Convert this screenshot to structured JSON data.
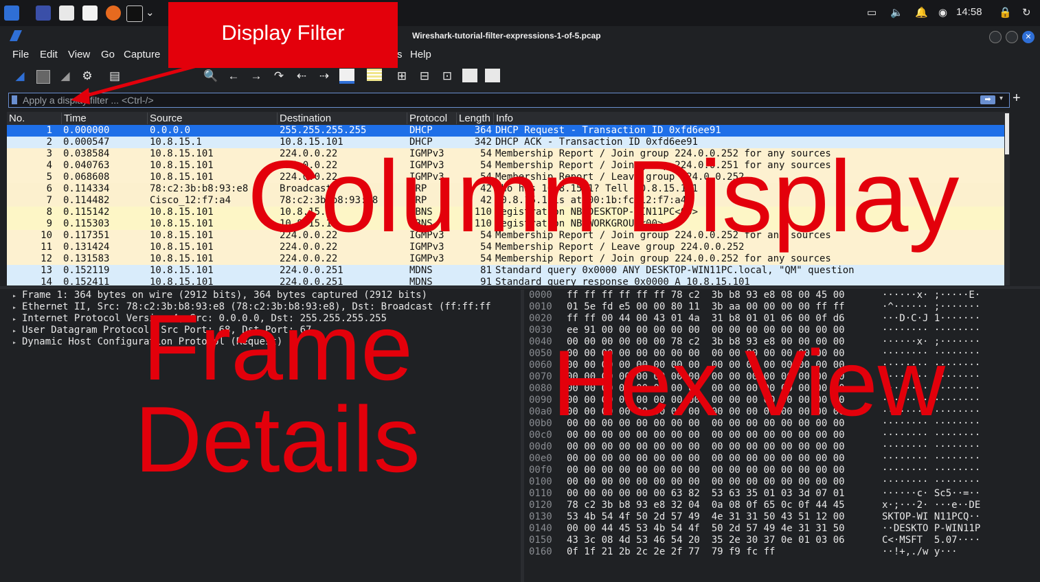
{
  "window": {
    "title": "Wireshark-tutorial-filter-expressions-1-of-5.pcap"
  },
  "taskbar": {
    "clock": "14:58"
  },
  "menu": {
    "file": "File",
    "edit": "Edit",
    "view": "View",
    "go": "Go",
    "capture": "Capture",
    "analyze_tail": "s",
    "help": "Help"
  },
  "filter": {
    "placeholder": "Apply a display filter ... <Ctrl-/>"
  },
  "packet_list": {
    "columns": [
      "No.",
      "Time",
      "Source",
      "Destination",
      "Protocol",
      "Length",
      "Info"
    ],
    "rows": [
      {
        "no": "1",
        "time": "0.000000",
        "src": "0.0.0.0",
        "dst": "255.255.255.255",
        "proto": "DHCP",
        "len": "364",
        "info": "DHCP Request  - Transaction ID 0xfd6ee91",
        "color": "#1e6fe8",
        "fg": "#ffffff"
      },
      {
        "no": "2",
        "time": "0.000547",
        "src": "10.8.15.1",
        "dst": "10.8.15.101",
        "proto": "DHCP",
        "len": "342",
        "info": "DHCP ACK      - Transaction ID 0xfd6ee91",
        "color": "#d9ecfb",
        "fg": "#111111"
      },
      {
        "no": "3",
        "time": "0.038584",
        "src": "10.8.15.101",
        "dst": "224.0.0.22",
        "proto": "IGMPv3",
        "len": "54",
        "info": "Membership Report / Join group 224.0.0.252 for any sources",
        "color": "#fdf1d0",
        "fg": "#111111"
      },
      {
        "no": "4",
        "time": "0.040763",
        "src": "10.8.15.101",
        "dst": "224.0.0.22",
        "proto": "IGMPv3",
        "len": "54",
        "info": "Membership Report / Join group 224.0.0.251 for any sources",
        "color": "#fdf1d0",
        "fg": "#111111"
      },
      {
        "no": "5",
        "time": "0.068608",
        "src": "10.8.15.101",
        "dst": "224.0.0.22",
        "proto": "IGMPv3",
        "len": "54",
        "info": "Membership Report / Leave group 224.0.0.252",
        "color": "#fdf1d0",
        "fg": "#111111"
      },
      {
        "no": "6",
        "time": "0.114334",
        "src": "78:c2:3b:b8:93:e8",
        "dst": "Broadcast",
        "proto": "ARP",
        "len": "42",
        "info": "Who has 10.8.15.1? Tell 10.8.15.101",
        "color": "#fcf0ce",
        "fg": "#111111"
      },
      {
        "no": "7",
        "time": "0.114482",
        "src": "Cisco_12:f7:a4",
        "dst": "78:c2:3b:b8:93:e8",
        "proto": "ARP",
        "len": "42",
        "info": "10.8.15.1 is at 00:1b:fc:12:f7:a4",
        "color": "#fcf0ce",
        "fg": "#111111"
      },
      {
        "no": "8",
        "time": "0.115142",
        "src": "10.8.15.101",
        "dst": "10.8.15.1",
        "proto": "NBNS",
        "len": "110",
        "info": "Registration NB DESKTOP-WIN11PC<00>",
        "color": "#fdf6c6",
        "fg": "#111111"
      },
      {
        "no": "9",
        "time": "0.115303",
        "src": "10.8.15.101",
        "dst": "10.8.15.1",
        "proto": "NBNS",
        "len": "110",
        "info": "Registration NB WORKGROUP<00>",
        "color": "#fdf6c6",
        "fg": "#111111"
      },
      {
        "no": "10",
        "time": "0.117351",
        "src": "10.8.15.101",
        "dst": "224.0.0.22",
        "proto": "IGMPv3",
        "len": "54",
        "info": "Membership Report / Join group 224.0.0.252 for any sources",
        "color": "#fdf1d0",
        "fg": "#111111"
      },
      {
        "no": "11",
        "time": "0.131424",
        "src": "10.8.15.101",
        "dst": "224.0.0.22",
        "proto": "IGMPv3",
        "len": "54",
        "info": "Membership Report / Leave group 224.0.0.252",
        "color": "#fdf1d0",
        "fg": "#111111"
      },
      {
        "no": "12",
        "time": "0.131583",
        "src": "10.8.15.101",
        "dst": "224.0.0.22",
        "proto": "IGMPv3",
        "len": "54",
        "info": "Membership Report / Join group 224.0.0.252 for any sources",
        "color": "#fdf1d0",
        "fg": "#111111"
      },
      {
        "no": "13",
        "time": "0.152119",
        "src": "10.8.15.101",
        "dst": "224.0.0.251",
        "proto": "MDNS",
        "len": "81",
        "info": "Standard query 0x0000 ANY DESKTOP-WIN11PC.local, \"QM\" question",
        "color": "#d9ecfb",
        "fg": "#111111"
      },
      {
        "no": "14",
        "time": "0.152411",
        "src": "10.8.15.101",
        "dst": "224.0.0.251",
        "proto": "MDNS",
        "len": "91",
        "info": "Standard query response 0x0000 A 10.8.15.101",
        "color": "#d9ecfb",
        "fg": "#111111"
      }
    ]
  },
  "details": {
    "rows": [
      "Frame 1: 364 bytes on wire (2912 bits), 364 bytes captured (2912 bits)",
      "Ethernet II, Src: 78:c2:3b:b8:93:e8 (78:c2:3b:b8:93:e8), Dst: Broadcast (ff:ff:ff",
      "Internet Protocol Version 4, Src: 0.0.0.0, Dst: 255.255.255.255",
      "User Datagram Protocol, Src Port: 68, Dst Port: 67",
      "Dynamic Host Configuration Protocol (Request)"
    ]
  },
  "hex": {
    "rows": [
      {
        "off": "0000",
        "bytes": "ff ff ff ff ff ff 78 c2  3b b8 93 e8 08 00 45 00",
        "ascii": "······x· ;·····E·"
      },
      {
        "off": "0010",
        "bytes": "01 5e fd e5 00 00 80 11  3b aa 00 00 00 00 ff ff",
        "ascii": "·^······ ;·······"
      },
      {
        "off": "0020",
        "bytes": "ff ff 00 44 00 43 01 4a  31 b8 01 01 06 00 0f d6",
        "ascii": "···D·C·J 1·······"
      },
      {
        "off": "0030",
        "bytes": "ee 91 00 00 00 00 00 00  00 00 00 00 00 00 00 00",
        "ascii": "········ ········"
      },
      {
        "off": "0040",
        "bytes": "00 00 00 00 00 00 78 c2  3b b8 93 e8 00 00 00 00",
        "ascii": "······x· ;·······"
      },
      {
        "off": "0050",
        "bytes": "00 00 00 00 00 00 00 00  00 00 00 00 00 00 00 00",
        "ascii": "········ ········"
      },
      {
        "off": "0060",
        "bytes": "00 00 00 00 00 00 00 00  00 00 00 00 00 00 00 00",
        "ascii": "········ ········"
      },
      {
        "off": "0070",
        "bytes": "00 00 00 00 00 00 00 00  00 00 00 00 00 00 00 00",
        "ascii": "········ ········"
      },
      {
        "off": "0080",
        "bytes": "00 00 00 00 00 00 00 00  00 00 00 00 00 00 00 00",
        "ascii": "········ ········"
      },
      {
        "off": "0090",
        "bytes": "00 00 00 00 00 00 00 00  00 00 00 00 00 00 00 00",
        "ascii": "········ ········"
      },
      {
        "off": "00a0",
        "bytes": "00 00 00 00 00 00 00 00  00 00 00 00 00 00 00 00",
        "ascii": "········ ········"
      },
      {
        "off": "00b0",
        "bytes": "00 00 00 00 00 00 00 00  00 00 00 00 00 00 00 00",
        "ascii": "········ ········"
      },
      {
        "off": "00c0",
        "bytes": "00 00 00 00 00 00 00 00  00 00 00 00 00 00 00 00",
        "ascii": "········ ········"
      },
      {
        "off": "00d0",
        "bytes": "00 00 00 00 00 00 00 00  00 00 00 00 00 00 00 00",
        "ascii": "········ ········"
      },
      {
        "off": "00e0",
        "bytes": "00 00 00 00 00 00 00 00  00 00 00 00 00 00 00 00",
        "ascii": "········ ········"
      },
      {
        "off": "00f0",
        "bytes": "00 00 00 00 00 00 00 00  00 00 00 00 00 00 00 00",
        "ascii": "········ ········"
      },
      {
        "off": "0100",
        "bytes": "00 00 00 00 00 00 00 00  00 00 00 00 00 00 00 00",
        "ascii": "········ ········"
      },
      {
        "off": "0110",
        "bytes": "00 00 00 00 00 00 63 82  53 63 35 01 03 3d 07 01",
        "ascii": "······c· Sc5··=··"
      },
      {
        "off": "0120",
        "bytes": "78 c2 3b b8 93 e8 32 04  0a 08 0f 65 0c 0f 44 45",
        "ascii": "x·;···2· ···e··DE"
      },
      {
        "off": "0130",
        "bytes": "53 4b 54 4f 50 2d 57 49  4e 31 31 50 43 51 12 00",
        "ascii": "SKTOP-WI N11PCQ··"
      },
      {
        "off": "0140",
        "bytes": "00 00 44 45 53 4b 54 4f  50 2d 57 49 4e 31 31 50",
        "ascii": "··DESKTO P-WIN11P"
      },
      {
        "off": "0150",
        "bytes": "43 3c 08 4d 53 46 54 20  35 2e 30 37 0e 01 03 06",
        "ascii": "C<·MSFT  5.07····"
      },
      {
        "off": "0160",
        "bytes": "0f 1f 21 2b 2c 2e 2f 77  79 f9 fc ff",
        "ascii": "··!+,./w y···"
      }
    ]
  },
  "annotations": {
    "display_filter": "Display Filter",
    "column_display": "Column Display",
    "frame_details_1": "Frame",
    "frame_details_2": "Details",
    "hex_view": "Hex View"
  },
  "colors": {
    "accent_blue": "#1e6fe8",
    "annotation_red": "#e3000b",
    "row_yellow": "#fdf1d0",
    "row_blue": "#d9ecfb"
  }
}
